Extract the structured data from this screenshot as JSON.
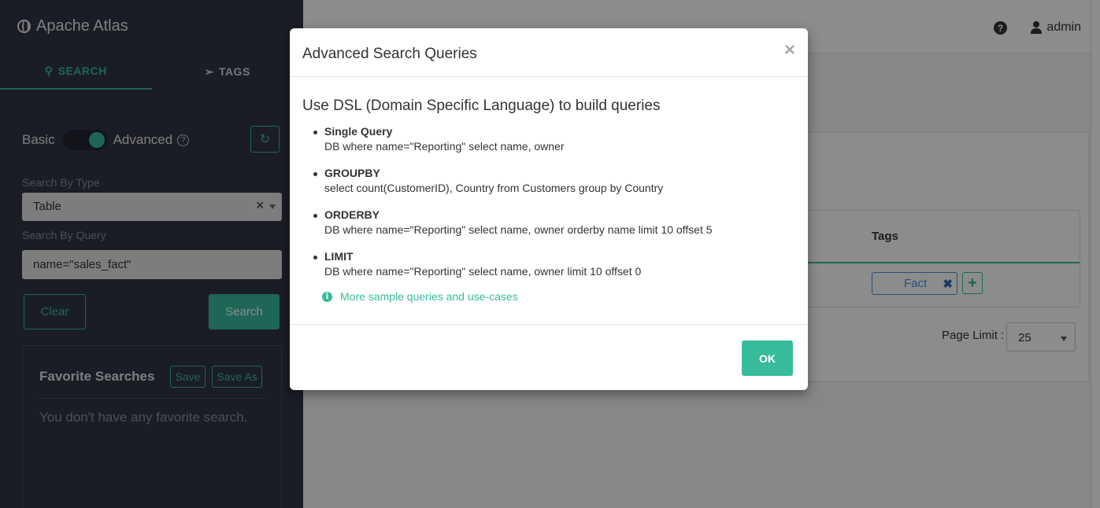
{
  "app": {
    "title": "Apache Atlas"
  },
  "sidebar": {
    "tabs": [
      {
        "label": "SEARCH",
        "icon": "search-icon",
        "active": true
      },
      {
        "label": "TAGS",
        "icon": "tag-icon",
        "active": false
      }
    ],
    "toggle": {
      "left_label": "Basic",
      "right_label": "Advanced",
      "state": "Advanced"
    },
    "search_by_type": {
      "label": "Search By Type",
      "value": "Table"
    },
    "search_by_query": {
      "label": "Search By Query",
      "value": "name=\"sales_fact\""
    },
    "clear_label": "Clear",
    "search_label": "Search",
    "favorites": {
      "title": "Favorite Searches",
      "save_label": "Save",
      "save_as_label": "Save As",
      "empty_text": "You don't have any favorite search."
    }
  },
  "header": {
    "user": "admin",
    "help_glyph": "?"
  },
  "results": {
    "column_tags": "Tags",
    "tag_value": "Fact",
    "page_limit_label": "Page Limit :",
    "page_limit_value": "25"
  },
  "modal": {
    "title": "Advanced Search Queries",
    "close_glyph": "×",
    "subtitle": "Use DSL (Domain Specific Language) to build queries",
    "queries": [
      {
        "name": "Single Query",
        "example": "DB where name=\"Reporting\" select name, owner"
      },
      {
        "name": "GROUPBY",
        "example": "select count(CustomerID), Country from Customers group by Country"
      },
      {
        "name": "ORDERBY",
        "example": "DB where name=\"Reporting\" select name, owner orderby name limit 10 offset 5"
      },
      {
        "name": "LIMIT",
        "example": "DB where name=\"Reporting\" select name, owner limit 10 offset 0"
      }
    ],
    "more_link": "More sample queries and use-cases",
    "ok_label": "OK"
  },
  "colors": {
    "accent": "#37bb9b",
    "sidebar_bg": "#323544",
    "tag_blue": "#4a90d9"
  }
}
